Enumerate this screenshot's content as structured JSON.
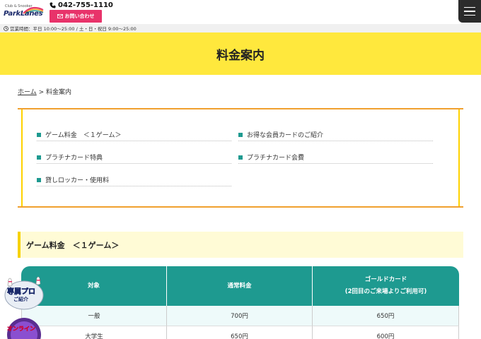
{
  "header": {
    "logo_small": "Club & Snooker",
    "logo_text": "ParkLanes",
    "phone": "042-755-1110",
    "contact_label": "お問い合わせ"
  },
  "hours": "営業時間：平日 10:00〜25:00 / 土・日・祝日 9:00〜25:00",
  "page_title": "料金案内",
  "breadcrumb": {
    "home": "ホーム",
    "separator": " > ",
    "current": "料金案内"
  },
  "toc": {
    "items": [
      {
        "label": "ゲーム料金　＜１ゲーム＞"
      },
      {
        "label": "お得な会員カードのご紹介"
      },
      {
        "label": "プラチナカード特典"
      },
      {
        "label": "プラチナカード会費"
      },
      {
        "label": "貸しロッカー・使用料"
      }
    ]
  },
  "section_title": "ゲーム料金　＜１ゲーム＞",
  "table": {
    "headers": [
      "対象",
      "通常料金",
      "ゴールドカード",
      "(2回目のご来場よりご利用可)"
    ],
    "rows": [
      [
        "一般",
        "700円",
        "650円"
      ],
      [
        "大学生",
        "650円",
        "600円"
      ]
    ]
  },
  "badges": {
    "pro_line1": "専属プロ",
    "pro_line2": "ご紹介",
    "online": "オンライン"
  },
  "colors": {
    "accent_yellow": "#ffe83d",
    "teal": "#1e9a90",
    "pink": "#e8336a",
    "orange_border": "#f0a02e"
  }
}
